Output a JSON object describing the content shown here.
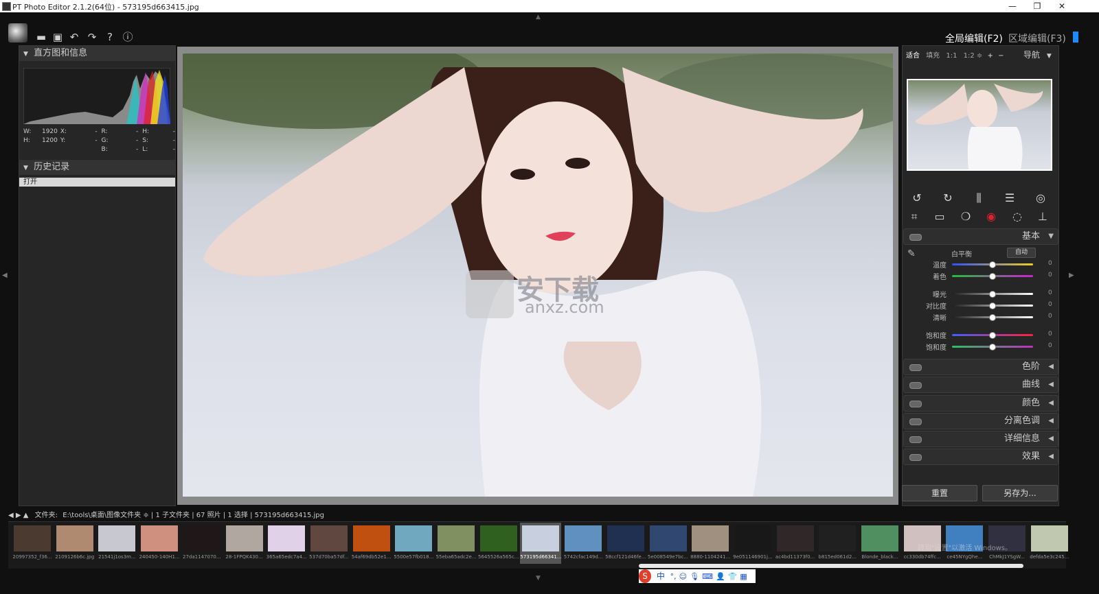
{
  "window": {
    "title": "PT Photo Editor 2.1.2(64位) - 573195d663415.jpg",
    "minimize": "—",
    "maximize": "❐",
    "close": "✕"
  },
  "toolbar": {
    "icons": [
      "folder-icon",
      "save-icon",
      "undo-icon",
      "redo-icon",
      "help-icon",
      "info-icon"
    ],
    "glyphs": [
      "▬",
      "▣",
      "↶",
      "↷",
      "?",
      "ⓘ"
    ]
  },
  "modes": {
    "global": "全局编辑(F2)",
    "local": "区域编辑(F3)"
  },
  "left_panel": {
    "histogram_title": "直方图和信息",
    "info": {
      "w_label": "W:",
      "w_value": "1920",
      "h_label": "H:",
      "h_value": "1200",
      "x_label": "X:",
      "x_value": "-",
      "y_label": "Y:",
      "y_value": "-",
      "r_label": "R:",
      "r_value": "-",
      "g_label": "G:",
      "g_value": "-",
      "b_label": "B:",
      "b_value": "-",
      "hh_label": "H:",
      "hh_value": "-",
      "s_label": "S:",
      "s_value": "-",
      "l_label": "L:",
      "l_value": "-"
    },
    "history_title": "历史记录",
    "history_items": [
      "打开"
    ]
  },
  "watermark": {
    "text": "安下载",
    "url": "anxz.com"
  },
  "right_panel": {
    "zoom_options": [
      "适合",
      "填充",
      "1:1",
      "1:2 ≑",
      "+",
      "−"
    ],
    "nav_label": "导航",
    "basic_label": "基本",
    "white_balance_label": "白平衡",
    "auto_label": "自动",
    "sliders": [
      {
        "label": "温度",
        "value": "0",
        "level": 0.5,
        "colors": [
          "#3050ff",
          "#f0d020"
        ]
      },
      {
        "label": "着色",
        "value": "0",
        "level": 0.5,
        "colors": [
          "#20c040",
          "#d020d0"
        ]
      },
      {
        "label": "曝光",
        "value": "0",
        "level": 0.5,
        "colors": [
          "#202020",
          "#ffffff"
        ]
      },
      {
        "label": "对比度",
        "value": "0",
        "level": 0.5,
        "colors": [
          "#202020",
          "#ffffff"
        ]
      },
      {
        "label": "清晰",
        "value": "0",
        "level": 0.5,
        "colors": [
          "#202020",
          "#ffffff"
        ]
      },
      {
        "label": "饱和度",
        "value": "0",
        "level": 0.5,
        "colors": [
          "#4060ff",
          "#ff2040"
        ]
      },
      {
        "label": "饱和度",
        "value": "0",
        "level": 0.5,
        "colors": [
          "#30c060",
          "#c030c0"
        ]
      }
    ],
    "sections": [
      "色阶",
      "曲线",
      "颜色",
      "分离色调",
      "详细信息",
      "效果"
    ],
    "reset_label": "重置",
    "save_as_label": "另存为..."
  },
  "path_bar": {
    "folder_label": "文件夹:",
    "path": "E:\\tools\\桌面\\图像文件夹 ≑",
    "stats": "| 1 子文件夹 | 67 照片 | 1 选择 | 573195d663415.jpg"
  },
  "filmstrip": [
    {
      "name": "20997352_f36...",
      "color": "#4a3a30"
    },
    {
      "name": "2109126b6c.jpg",
      "color": "#b08a70"
    },
    {
      "name": "21541j1os3m...",
      "color": "#c8c8d0"
    },
    {
      "name": "240450-140H1...",
      "color": "#d09080"
    },
    {
      "name": "27da1147070...",
      "color": "#201818"
    },
    {
      "name": "28-1FPQK430...",
      "color": "#b0a8a0"
    },
    {
      "name": "365a65edc7a4...",
      "color": "#e0d0e8"
    },
    {
      "name": "537d70ba57df...",
      "color": "#604840"
    },
    {
      "name": "54af69db52e1...",
      "color": "#c05010"
    },
    {
      "name": "5500e57fb018...",
      "color": "#70a8c0"
    },
    {
      "name": "55eba65adc2e...",
      "color": "#809060"
    },
    {
      "name": "5645526a565c...",
      "color": "#306020"
    },
    {
      "name": "573195d66341...",
      "color": "#c8d0e0"
    },
    {
      "name": "5742cfac149d...",
      "color": "#6090c0"
    },
    {
      "name": "58ccf121d46fe...",
      "color": "#203050"
    },
    {
      "name": "5e008549e7bc...",
      "color": "#304870"
    },
    {
      "name": "8880-1104241...",
      "color": "#a09080"
    },
    {
      "name": "9e051146901j...",
      "color": "#181818"
    },
    {
      "name": "ac4bd11373f0...",
      "color": "#302828"
    },
    {
      "name": "b815ed061d2...",
      "color": "#202020"
    },
    {
      "name": "Blonde_black...",
      "color": "#509060"
    },
    {
      "name": "cc330db74ffc...",
      "color": "#d0c0c0"
    },
    {
      "name": "ce45NYgQhe...",
      "color": "#4080c0"
    },
    {
      "name": "ChMkJ1YSgW...",
      "color": "#303040"
    },
    {
      "name": "defda5e3c245...",
      "color": "#c0c8b0"
    }
  ],
  "taskbar": {
    "ime_label": "中",
    "icons": [
      "°,",
      "☺",
      "🎙",
      "⌨",
      "👤",
      "👕",
      "▦"
    ]
  },
  "activate_windows": "转到\"设置\"以激活 Windows。"
}
